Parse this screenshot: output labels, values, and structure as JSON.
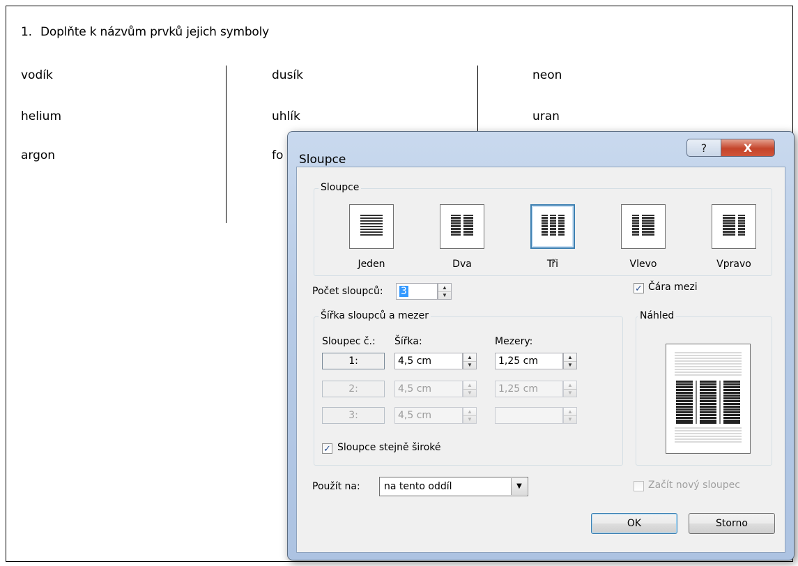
{
  "document": {
    "heading_number": "1.",
    "heading_text": "Doplňte k názvům prvků jejich symboly",
    "words": [
      "vodík",
      "helium",
      "argon",
      "dusík",
      "uhlík",
      "fo",
      "neon",
      "uran"
    ]
  },
  "dialog": {
    "title": "Sloupce",
    "help_glyph": "?",
    "close_glyph": "X",
    "presets_group_label": "Sloupce",
    "presets": [
      {
        "label": "Jeden",
        "icon": "one-column-icon"
      },
      {
        "label": "Dva",
        "icon": "two-columns-icon"
      },
      {
        "label": "Tři",
        "icon": "three-columns-icon",
        "selected": true
      },
      {
        "label": "Vlevo",
        "icon": "left-column-icon"
      },
      {
        "label": "Vpravo",
        "icon": "right-column-icon"
      }
    ],
    "column_count_label": "Počet sloupců:",
    "column_count_value": "3",
    "line_between_label": "Čára mezi",
    "line_between_checked": true,
    "width_group_label": "Šířka sloupců a mezer",
    "col_header": "Sloupec č.:",
    "width_header": "Šířka:",
    "spacing_header": "Mezery:",
    "rows": [
      {
        "num": "1:",
        "width": "4,5 cm",
        "spacing": "1,25 cm",
        "enabled": true
      },
      {
        "num": "2:",
        "width": "4,5 cm",
        "spacing": "1,25 cm",
        "enabled": false
      },
      {
        "num": "3:",
        "width": "4,5 cm",
        "spacing": "",
        "enabled": false
      }
    ],
    "equal_width_label": "Sloupce stejně široké",
    "equal_width_checked": true,
    "preview_label": "Náhled",
    "apply_to_label": "Použít na:",
    "apply_to_value": "na tento oddíl",
    "new_column_label": "Začít nový sloupec",
    "new_column_checked": false,
    "ok_label": "OK",
    "cancel_label": "Storno",
    "check_glyph": "✓",
    "spin_up_glyph": "▲",
    "spin_down_glyph": "▼",
    "dropdown_glyph": "▼"
  }
}
